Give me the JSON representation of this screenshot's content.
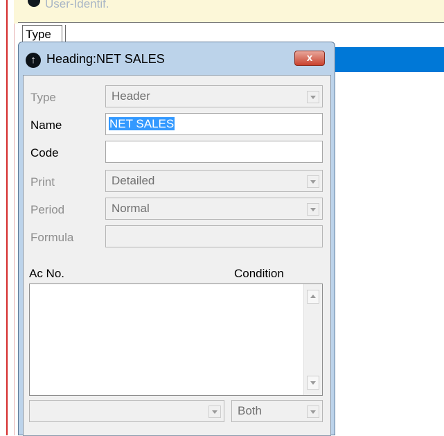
{
  "background_window": {
    "title": "User-Identif.",
    "column_header": "Type"
  },
  "dialog": {
    "title": "Heading:NET SALES",
    "close_label": "x",
    "fields": {
      "type": {
        "label": "Type",
        "value": "Header"
      },
      "name": {
        "label": "Name",
        "value": "NET SALES"
      },
      "code": {
        "label": "Code",
        "value": ""
      },
      "print": {
        "label": "Print",
        "value": "Detailed"
      },
      "period": {
        "label": "Period",
        "value": "Normal"
      },
      "formula": {
        "label": "Formula",
        "value": ""
      }
    },
    "list": {
      "col_acno": "Ac No.",
      "col_condition": "Condition"
    },
    "bottom": {
      "account_combo": "",
      "condition_combo": "Both"
    }
  }
}
